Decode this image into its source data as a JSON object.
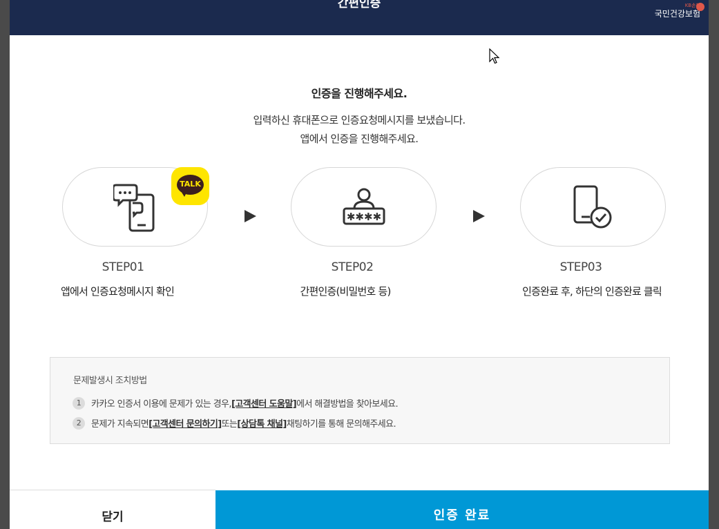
{
  "header": {
    "title": "간편인증",
    "brand_sub": "KB손해",
    "brand_name": "국민건강보험"
  },
  "main": {
    "heading": "인증을 진행해주세요.",
    "description_line1": "입력하신 휴대폰으로 인증요청메시지를 보냈습니다.",
    "description_line2": "앱에서 인증을 진행해주세요."
  },
  "steps": [
    {
      "label": "STEP01",
      "text": "앱에서 인증요청메시지 확인",
      "icon": "phone-chat-icon",
      "badge": "TALK"
    },
    {
      "label": "STEP02",
      "text": "간편인증(비밀번호 등)",
      "icon": "password-user-icon"
    },
    {
      "label": "STEP03",
      "text": "인증완료 후, 하단의 인증완료 클릭",
      "icon": "phone-check-icon"
    }
  ],
  "help": {
    "title": "문제발생시 조치방법",
    "items": [
      {
        "num": "1",
        "before": "카카오 인증서 이용에 문제가 있는 경우, ",
        "link1": "[고객센터 도움말]",
        "middle": " 에서 해결방법을 찾아보세요.",
        "link2": "",
        "after": ""
      },
      {
        "num": "2",
        "before": "문제가 지속되면 ",
        "link1": "[고객센터 문의하기]",
        "middle": " 또는 ",
        "link2": "[상담톡 채널]",
        "after": " 채팅하기를 통해 문의해주세요."
      }
    ]
  },
  "footer": {
    "close_label": "닫기",
    "complete_label": "인증 완료"
  },
  "colors": {
    "header_bg": "#1b2a4e",
    "kakao_yellow": "#fee500",
    "complete_button": "#0098d6"
  }
}
